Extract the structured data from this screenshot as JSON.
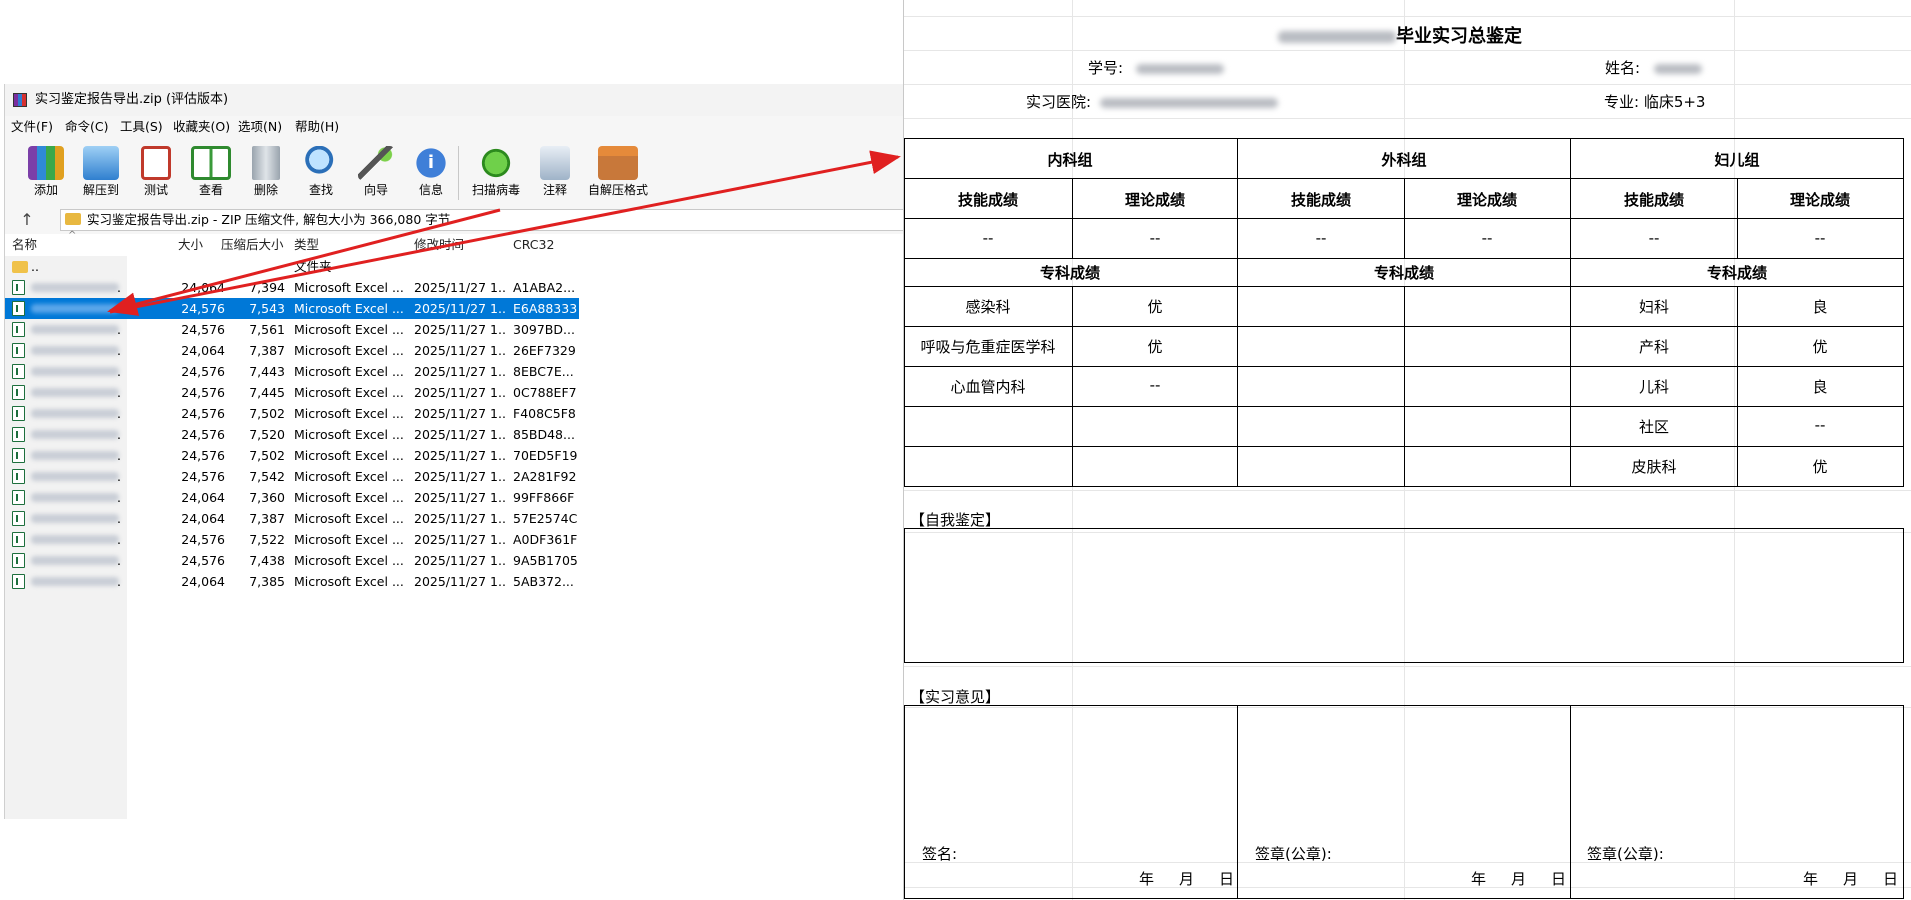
{
  "winrar": {
    "title": "实习鉴定报告导出.zip (评估版本)",
    "menu": [
      "文件(F)",
      "命令(C)",
      "工具(S)",
      "收藏夹(O)",
      "选项(N)",
      "帮助(H)"
    ],
    "toolbar": [
      "添加",
      "解压到",
      "测试",
      "查看",
      "删除",
      "查找",
      "向导",
      "信息",
      "扫描病毒",
      "注释",
      "自解压格式"
    ],
    "address": "实习鉴定报告导出.zip - ZIP 压缩文件, 解包大小为 366,080 字节",
    "columns": [
      "名称",
      "大小",
      "压缩后大小",
      "类型",
      "修改时间",
      "CRC32"
    ],
    "parent_row": {
      "name": "..",
      "type": "文件夹"
    },
    "rows": [
      {
        "size": "24,064",
        "packed": "7,394",
        "type": "Microsoft Excel ...",
        "modified": "2025/11/27 1...",
        "crc": "A1ABA2..."
      },
      {
        "size": "24,576",
        "packed": "7,543",
        "type": "Microsoft Excel ...",
        "modified": "2025/11/27 1...",
        "crc": "E6A88333"
      },
      {
        "size": "24,576",
        "packed": "7,561",
        "type": "Microsoft Excel ...",
        "modified": "2025/11/27 1...",
        "crc": "3097BD..."
      },
      {
        "size": "24,064",
        "packed": "7,387",
        "type": "Microsoft Excel ...",
        "modified": "2025/11/27 1...",
        "crc": "26EF7329"
      },
      {
        "size": "24,576",
        "packed": "7,443",
        "type": "Microsoft Excel ...",
        "modified": "2025/11/27 1...",
        "crc": "8EBC7E..."
      },
      {
        "size": "24,576",
        "packed": "7,445",
        "type": "Microsoft Excel ...",
        "modified": "2025/11/27 1...",
        "crc": "0C788EF7"
      },
      {
        "size": "24,576",
        "packed": "7,502",
        "type": "Microsoft Excel ...",
        "modified": "2025/11/27 1...",
        "crc": "F408C5F8"
      },
      {
        "size": "24,576",
        "packed": "7,520",
        "type": "Microsoft Excel ...",
        "modified": "2025/11/27 1...",
        "crc": "85BD48..."
      },
      {
        "size": "24,576",
        "packed": "7,502",
        "type": "Microsoft Excel ...",
        "modified": "2025/11/27 1...",
        "crc": "70ED5F19"
      },
      {
        "size": "24,576",
        "packed": "7,542",
        "type": "Microsoft Excel ...",
        "modified": "2025/11/27 1...",
        "crc": "2A281F92"
      },
      {
        "size": "24,064",
        "packed": "7,360",
        "type": "Microsoft Excel ...",
        "modified": "2025/11/27 1...",
        "crc": "99FF866F"
      },
      {
        "size": "24,064",
        "packed": "7,387",
        "type": "Microsoft Excel ...",
        "modified": "2025/11/27 1...",
        "crc": "57E2574C"
      },
      {
        "size": "24,576",
        "packed": "7,522",
        "type": "Microsoft Excel ...",
        "modified": "2025/11/27 1...",
        "crc": "A0DF361F"
      },
      {
        "size": "24,576",
        "packed": "7,438",
        "type": "Microsoft Excel ...",
        "modified": "2025/11/27 1...",
        "crc": "9A5B1705"
      },
      {
        "size": "24,064",
        "packed": "7,385",
        "type": "Microsoft Excel ...",
        "modified": "2025/11/27 1...",
        "crc": "5AB372..."
      }
    ],
    "selected_row": 1
  },
  "form": {
    "title_suffix": "毕业实习总鉴定",
    "student_id_label": "学号:",
    "name_label": "姓名:",
    "hospital_label": "实习医院:",
    "major": "专业: 临床5+3",
    "groups": [
      "内科组",
      "外科组",
      "妇儿组"
    ],
    "skill_label": "技能成绩",
    "theory_label": "理论成绩",
    "empty_mark": "--",
    "specialty_label": "专科成绩",
    "internal": [
      {
        "dept": "感染科",
        "grade": "优"
      },
      {
        "dept": "呼吸与危重症医学科",
        "grade": "优"
      },
      {
        "dept": "心血管内科",
        "grade": "--"
      }
    ],
    "pediatric": [
      {
        "dept": "妇科",
        "grade": "良"
      },
      {
        "dept": "产科",
        "grade": "优"
      },
      {
        "dept": "儿科",
        "grade": "良"
      },
      {
        "dept": "社区",
        "grade": "--"
      },
      {
        "dept": "皮肤科",
        "grade": "优"
      }
    ],
    "self_assessment": "【自我鉴定】",
    "internship_opinion": "【实习意见】",
    "sign_label": "签名:",
    "seal_label": "签章(公章):",
    "year": "年",
    "month": "月",
    "day": "日"
  },
  "colors": {
    "selection": "#0078d7",
    "arrow": "#e02020"
  }
}
